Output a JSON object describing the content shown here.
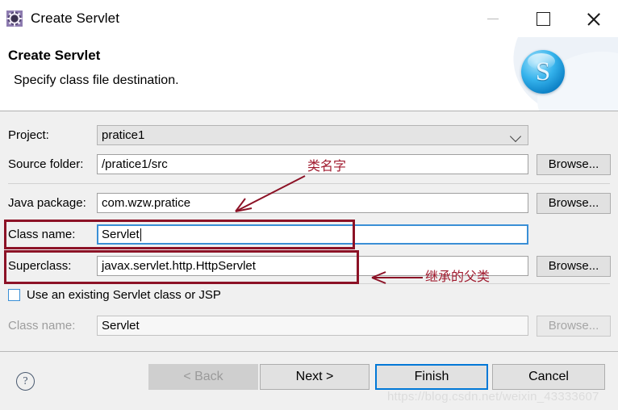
{
  "window": {
    "title": "Create Servlet",
    "icon": "gear-icon",
    "minimize_label": "—",
    "maximize_label": "□",
    "close_label": "✕"
  },
  "wizard": {
    "title": "Create Servlet",
    "subtitle": "Specify class file destination.",
    "banner_logo": "servlet-s-logo",
    "banner_letter": "S"
  },
  "form": {
    "fields": [
      {
        "label": "Project:",
        "value": "pratice1",
        "control": "combo",
        "state": "readonly",
        "browse": null
      },
      {
        "label": "Source folder:",
        "value": "/pratice1/src",
        "control": "text",
        "state": "normal",
        "browse": "Browse..."
      },
      {
        "label": "Java package:",
        "value": "com.wzw.pratice",
        "control": "text",
        "state": "normal",
        "browse": "Browse..."
      },
      {
        "label": "Class name:",
        "value": "Servlet",
        "control": "text",
        "state": "focused",
        "browse": null
      },
      {
        "label": "Superclass:",
        "value": "javax.servlet.http.HttpServlet",
        "control": "text",
        "state": "normal",
        "browse": "Browse..."
      }
    ],
    "checkbox": {
      "label": "Use an existing Servlet class or JSP",
      "checked": false
    },
    "existing_class": {
      "label": "Class name:",
      "value": "Servlet",
      "state": "disabled",
      "browse": "Browse..."
    }
  },
  "footer": {
    "help_icon": "question-mark-icon",
    "help_glyph": "?",
    "buttons": [
      {
        "label": "< Back",
        "state": "disabled"
      },
      {
        "label": "Next >",
        "state": "normal"
      },
      {
        "label": "Finish",
        "state": "default"
      },
      {
        "label": "Cancel",
        "state": "normal"
      }
    ]
  },
  "annotations": {
    "color": "#8c1226",
    "text_color": "#a01a2e",
    "class_name_note": "类名字",
    "superclass_note": "继承的父类"
  },
  "watermark": "https://blog.csdn.net/weixin_43333607"
}
